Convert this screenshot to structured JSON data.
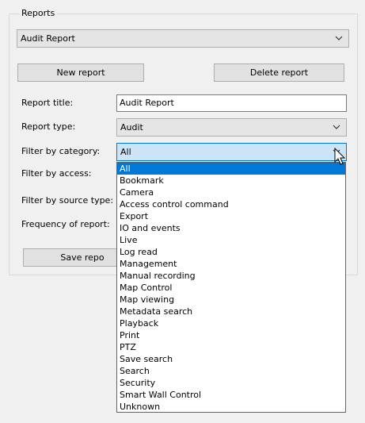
{
  "group": {
    "title": "Reports"
  },
  "report_select": {
    "value": "Audit Report"
  },
  "buttons": {
    "new": "New report",
    "delete": "Delete report",
    "save": "Save repo"
  },
  "fields": {
    "title_label": "Report title:",
    "title_value": "Audit Report",
    "type_label": "Report type:",
    "type_value": "Audit",
    "category_label": "Filter by category:",
    "category_value": "All",
    "access_label": "Filter by access:",
    "source_label": "Filter by source type:",
    "frequency_label": "Frequency of report:"
  },
  "category_options": [
    "All",
    "Bookmark",
    "Camera",
    "Access control command",
    "Export",
    "IO and events",
    "Live",
    "Log read",
    "Management",
    "Manual recording",
    "Map Control",
    "Map viewing",
    "Metadata search",
    "Playback",
    "Print",
    "PTZ",
    "Save search",
    "Search",
    "Security",
    "Smart Wall Control",
    "Unknown"
  ],
  "selected_option": "All",
  "icons": {
    "dropdown": "chevron-down-icon",
    "pointer": "mouse-pointer-icon"
  },
  "colors": {
    "selection": "#0078d7",
    "focus": "#cce4f7"
  }
}
